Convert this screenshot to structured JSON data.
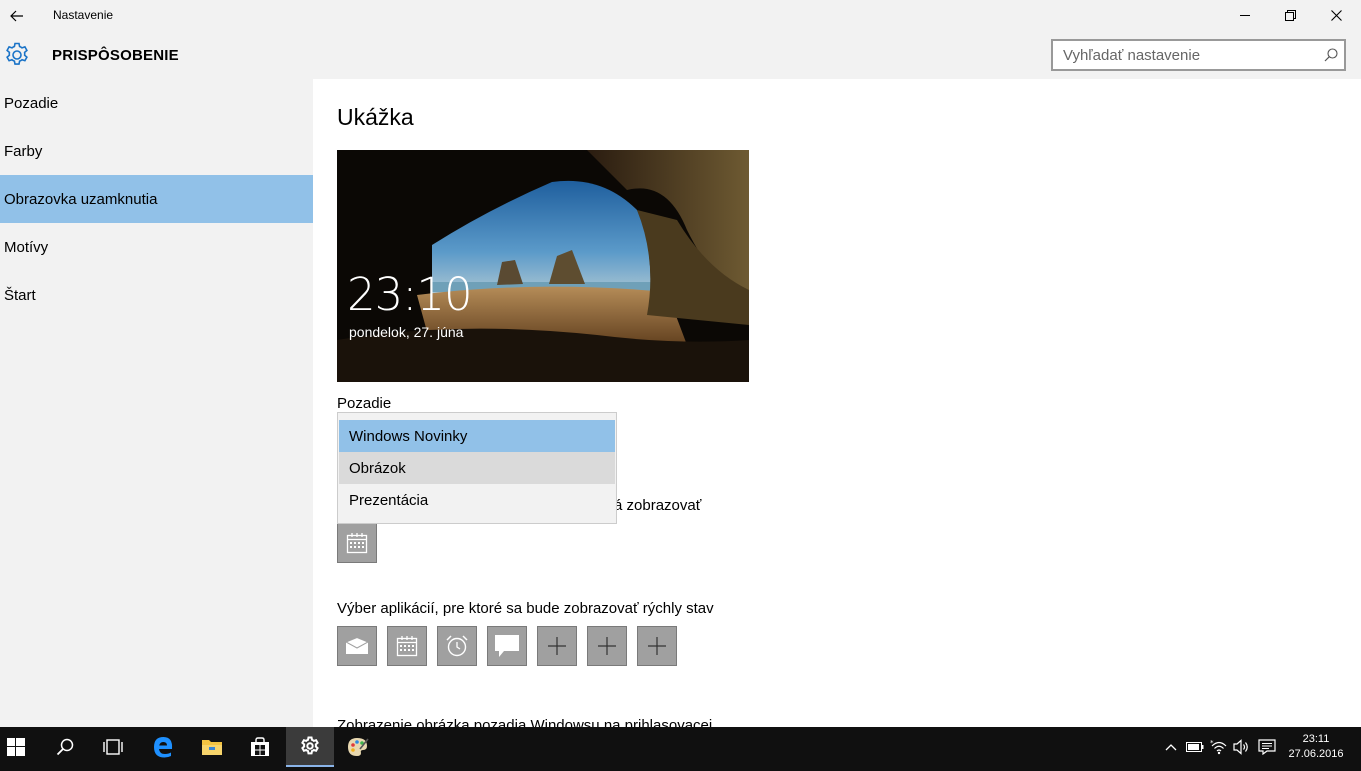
{
  "window": {
    "title": "Nastavenie",
    "minimize_glyph": "—",
    "maximize_glyph": "❐",
    "close_glyph": "✕"
  },
  "header": {
    "section_title": "PRISPÔSOBENIE",
    "search_placeholder": "Vyhľadať nastavenie"
  },
  "sidebar": {
    "items": [
      {
        "label": "Pozadie",
        "active": false
      },
      {
        "label": "Farby",
        "active": false
      },
      {
        "label": "Obrazovka uzamknutia",
        "active": true
      },
      {
        "label": "Motívy",
        "active": false
      },
      {
        "label": "Štart",
        "active": false
      }
    ]
  },
  "main": {
    "preview_heading": "Ukážka",
    "preview": {
      "time": "23:10",
      "date": "pondelok, 27. júna"
    },
    "background_label": "Pozadie",
    "background_dropdown": {
      "options": [
        "Windows Novinky",
        "Obrázok",
        "Prezentácia"
      ],
      "selected": "Windows Novinky",
      "hovered": "Obrázok"
    },
    "detailed_status_label_visible_tail": "á zobrazovať",
    "quick_status_label": "Výber aplikácií, pre ktoré sa bude zobrazovať rýchly stav",
    "quick_status_apps": [
      "mail-icon",
      "calendar-icon",
      "alarm-icon",
      "message-icon",
      "plus-icon",
      "plus-icon",
      "plus-icon"
    ],
    "bottom_label_partial": "Zobrazenie obrázka pozadia Windowsu na prihlasovacej"
  },
  "taskbar": {
    "apps": [
      "start-icon",
      "search-icon",
      "task-view-icon",
      "edge-icon",
      "file-explorer-icon",
      "store-icon",
      "settings-icon",
      "paint-icon"
    ],
    "active_app": "settings-icon",
    "tray": [
      "chevron-up-icon",
      "battery-icon",
      "wifi-icon",
      "volume-icon",
      "action-center-icon"
    ],
    "time": "23:11",
    "date": "27.06.2016"
  },
  "colors": {
    "selection": "#91c1e8",
    "chrome": "#f2f2f2",
    "taskbar": "#101010",
    "accent": "#0078d7"
  }
}
